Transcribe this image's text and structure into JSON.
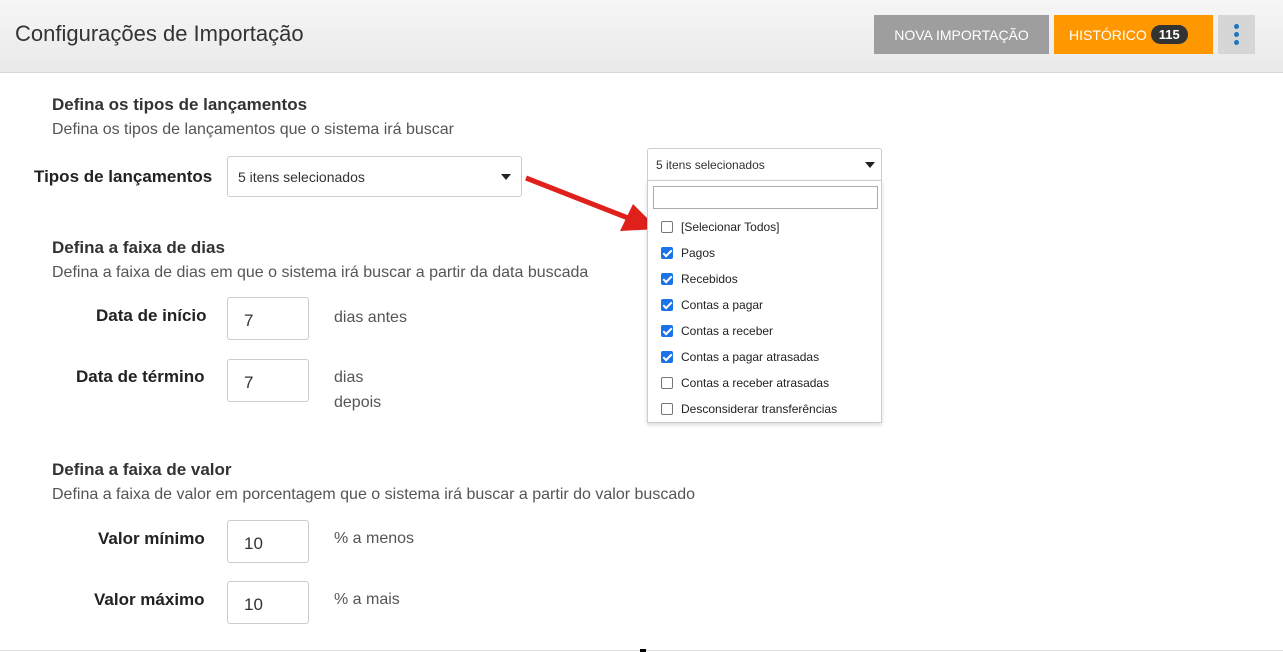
{
  "header": {
    "title": "Configurações de Importação",
    "nova_label": "NOVA IMPORTAÇÃO",
    "historico_label": "HISTÓRICO",
    "historico_count": "115"
  },
  "tipos": {
    "title": "Defina os tipos de lançamentos",
    "desc": "Defina os tipos de lançamentos que o sistema irá buscar",
    "label": "Tipos de lançamentos",
    "selected": "5 itens selecionados"
  },
  "dropdown": {
    "selected": "5 itens selecionados",
    "search_value": "",
    "options": [
      {
        "label": "[Selecionar Todos]",
        "checked": false
      },
      {
        "label": "Pagos",
        "checked": true
      },
      {
        "label": "Recebidos",
        "checked": true
      },
      {
        "label": "Contas a pagar",
        "checked": true
      },
      {
        "label": "Contas a receber",
        "checked": true
      },
      {
        "label": "Contas a pagar atrasadas",
        "checked": true
      },
      {
        "label": "Contas a receber atrasadas",
        "checked": false
      },
      {
        "label": "Desconsiderar transferências",
        "checked": false
      }
    ]
  },
  "dias": {
    "title": "Defina a faixa de dias",
    "desc": "Defina a faixa de dias em que o sistema irá buscar a partir da data buscada",
    "inicio_label": "Data de início",
    "inicio_value": "7",
    "inicio_unit": "dias antes",
    "termino_label": "Data de término",
    "termino_value": "7",
    "termino_unit_1": "dias",
    "termino_unit_2": "depois"
  },
  "valor": {
    "title": "Defina a faixa de valor",
    "desc": "Defina a faixa de valor em porcentagem que o sistema irá buscar a partir do valor buscado",
    "min_label": "Valor mínimo",
    "min_value": "10",
    "min_unit": "% a menos",
    "max_label": "Valor máximo",
    "max_value": "10",
    "max_unit": "% a mais"
  },
  "colors": {
    "accent_orange": "#ff9800",
    "button_gray": "#9e9e9e",
    "checkbox_blue": "#1a73e8",
    "arrow_red": "#e0201b"
  }
}
